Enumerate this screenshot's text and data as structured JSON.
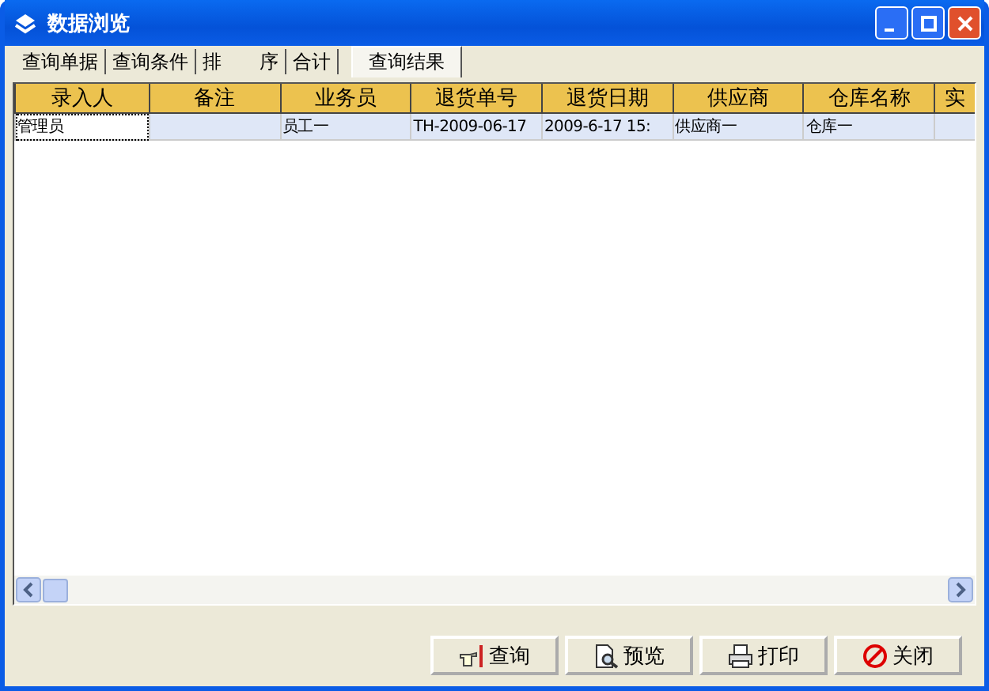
{
  "window": {
    "title": "数据浏览"
  },
  "tabs": [
    {
      "label": "查询单据",
      "selected": false
    },
    {
      "label": "查询条件",
      "selected": false
    },
    {
      "label": "排　　序",
      "selected": false
    },
    {
      "label": "合计",
      "selected": false
    },
    {
      "label": "查询结果",
      "selected": true
    }
  ],
  "table": {
    "columns": [
      "录入人",
      "备注",
      "业务员",
      "退货单号",
      "退货日期",
      "供应商",
      "仓库名称",
      "实"
    ],
    "rows": [
      {
        "selected": true,
        "cells": [
          "管理员",
          "",
          "员工一",
          "TH-2009-06-17",
          "2009-6-17 15:",
          "供应商一",
          "仓库一",
          ""
        ]
      }
    ]
  },
  "buttons": [
    {
      "label": "查询",
      "kind": "query"
    },
    {
      "label": "预览",
      "kind": "preview"
    },
    {
      "label": "打印",
      "kind": "print"
    },
    {
      "label": "关闭",
      "kind": "close"
    }
  ]
}
